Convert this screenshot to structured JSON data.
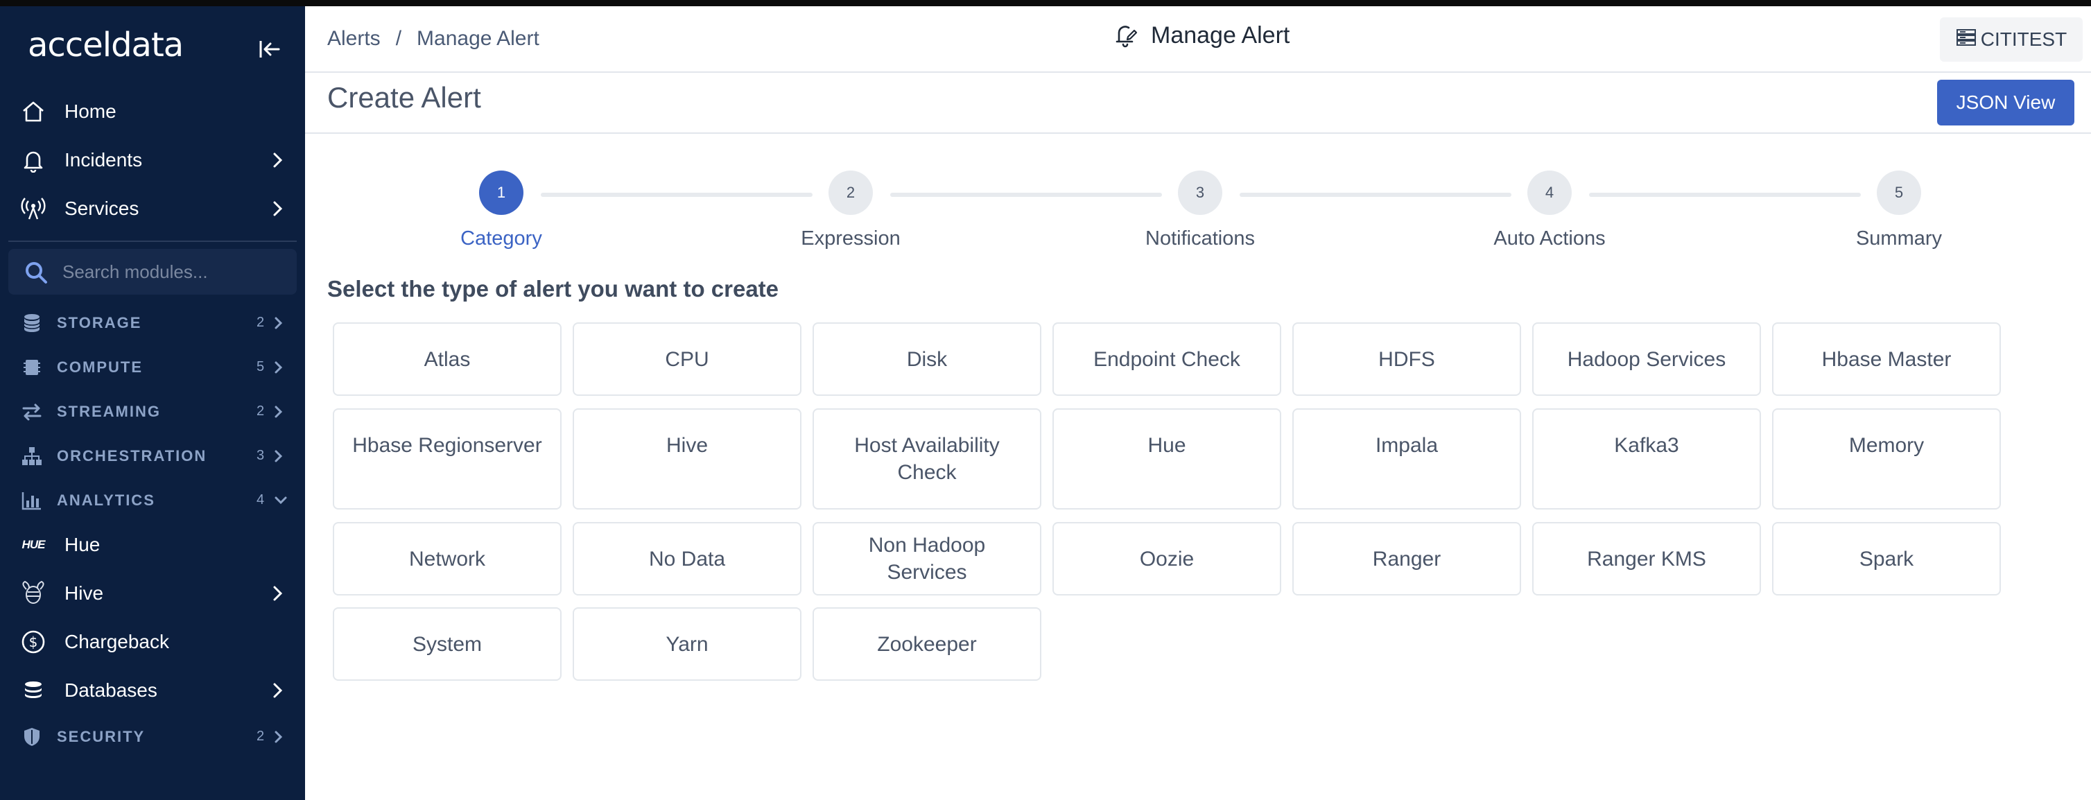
{
  "app": {
    "logo_text": "acceldata",
    "colors": {
      "sidebar_bg": "#0c1f3f",
      "accent": "#3b63c4"
    }
  },
  "sidebar": {
    "nav": [
      {
        "label": "Home",
        "icon": "home-icon",
        "has_chevron": false
      },
      {
        "label": "Incidents",
        "icon": "bell-icon",
        "has_chevron": true
      },
      {
        "label": "Services",
        "icon": "broadcast-icon",
        "has_chevron": true
      }
    ],
    "search": {
      "placeholder": "Search modules..."
    },
    "sections": [
      {
        "label": "STORAGE",
        "count": "2",
        "icon": "database-icon",
        "expanded": false
      },
      {
        "label": "COMPUTE",
        "count": "5",
        "icon": "chip-icon",
        "expanded": false
      },
      {
        "label": "STREAMING",
        "count": "2",
        "icon": "arrows-exchange-icon",
        "expanded": false
      },
      {
        "label": "ORCHESTRATION",
        "count": "3",
        "icon": "hierarchy-icon",
        "expanded": false
      },
      {
        "label": "ANALYTICS",
        "count": "4",
        "icon": "bar-chart-icon",
        "expanded": true
      }
    ],
    "analytics_items": [
      {
        "label": "Hue",
        "icon": "hue-logo-icon",
        "has_chevron": false
      },
      {
        "label": "Hive",
        "icon": "hive-bee-icon",
        "has_chevron": true
      },
      {
        "label": "Chargeback",
        "icon": "dollar-circle-icon",
        "has_chevron": false
      },
      {
        "label": "Databases",
        "icon": "database-stack-icon",
        "has_chevron": true
      }
    ],
    "security": {
      "label": "SECURITY",
      "count": "2",
      "icon": "shield-icon"
    }
  },
  "header": {
    "breadcrumb": [
      "Alerts",
      "/",
      "Manage Alert"
    ],
    "title": "Manage Alert",
    "title_icon": "bell-edit-icon",
    "cluster": "CITITEST",
    "cluster_icon": "server-icon"
  },
  "subheader": {
    "title": "Create Alert",
    "json_button": "JSON View"
  },
  "stepper": {
    "active_index": 0,
    "steps": [
      {
        "number": "1",
        "label": "Category"
      },
      {
        "number": "2",
        "label": "Expression"
      },
      {
        "number": "3",
        "label": "Notifications"
      },
      {
        "number": "4",
        "label": "Auto Actions"
      },
      {
        "number": "5",
        "label": "Summary"
      }
    ]
  },
  "main": {
    "prompt": "Select the type of alert you want to create",
    "categories": [
      "Atlas",
      "CPU",
      "Disk",
      "Endpoint Check",
      "HDFS",
      "Hadoop Services",
      "Hbase Master",
      "Hbase Regionserver",
      "Hive",
      "Host Availability Check",
      "Hue",
      "Impala",
      "Kafka3",
      "Memory",
      "Network",
      "No Data",
      "Non Hadoop Services",
      "Oozie",
      "Ranger",
      "Ranger KMS",
      "Spark",
      "System",
      "Yarn",
      "Zookeeper"
    ]
  }
}
